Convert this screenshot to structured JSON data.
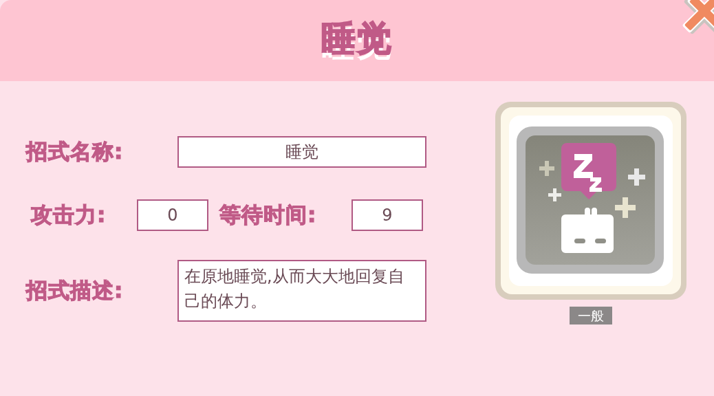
{
  "title": "睡觉",
  "name": {
    "label": "招式名称:",
    "value": "睡觉"
  },
  "attack": {
    "label": "攻击力:",
    "value": "0"
  },
  "wait_time": {
    "label": "等待时间:",
    "value": "9"
  },
  "description": {
    "label": "招式描述:",
    "value": "在原地睡觉,从而大大地回复自己的体力。"
  },
  "rarity": "一般"
}
